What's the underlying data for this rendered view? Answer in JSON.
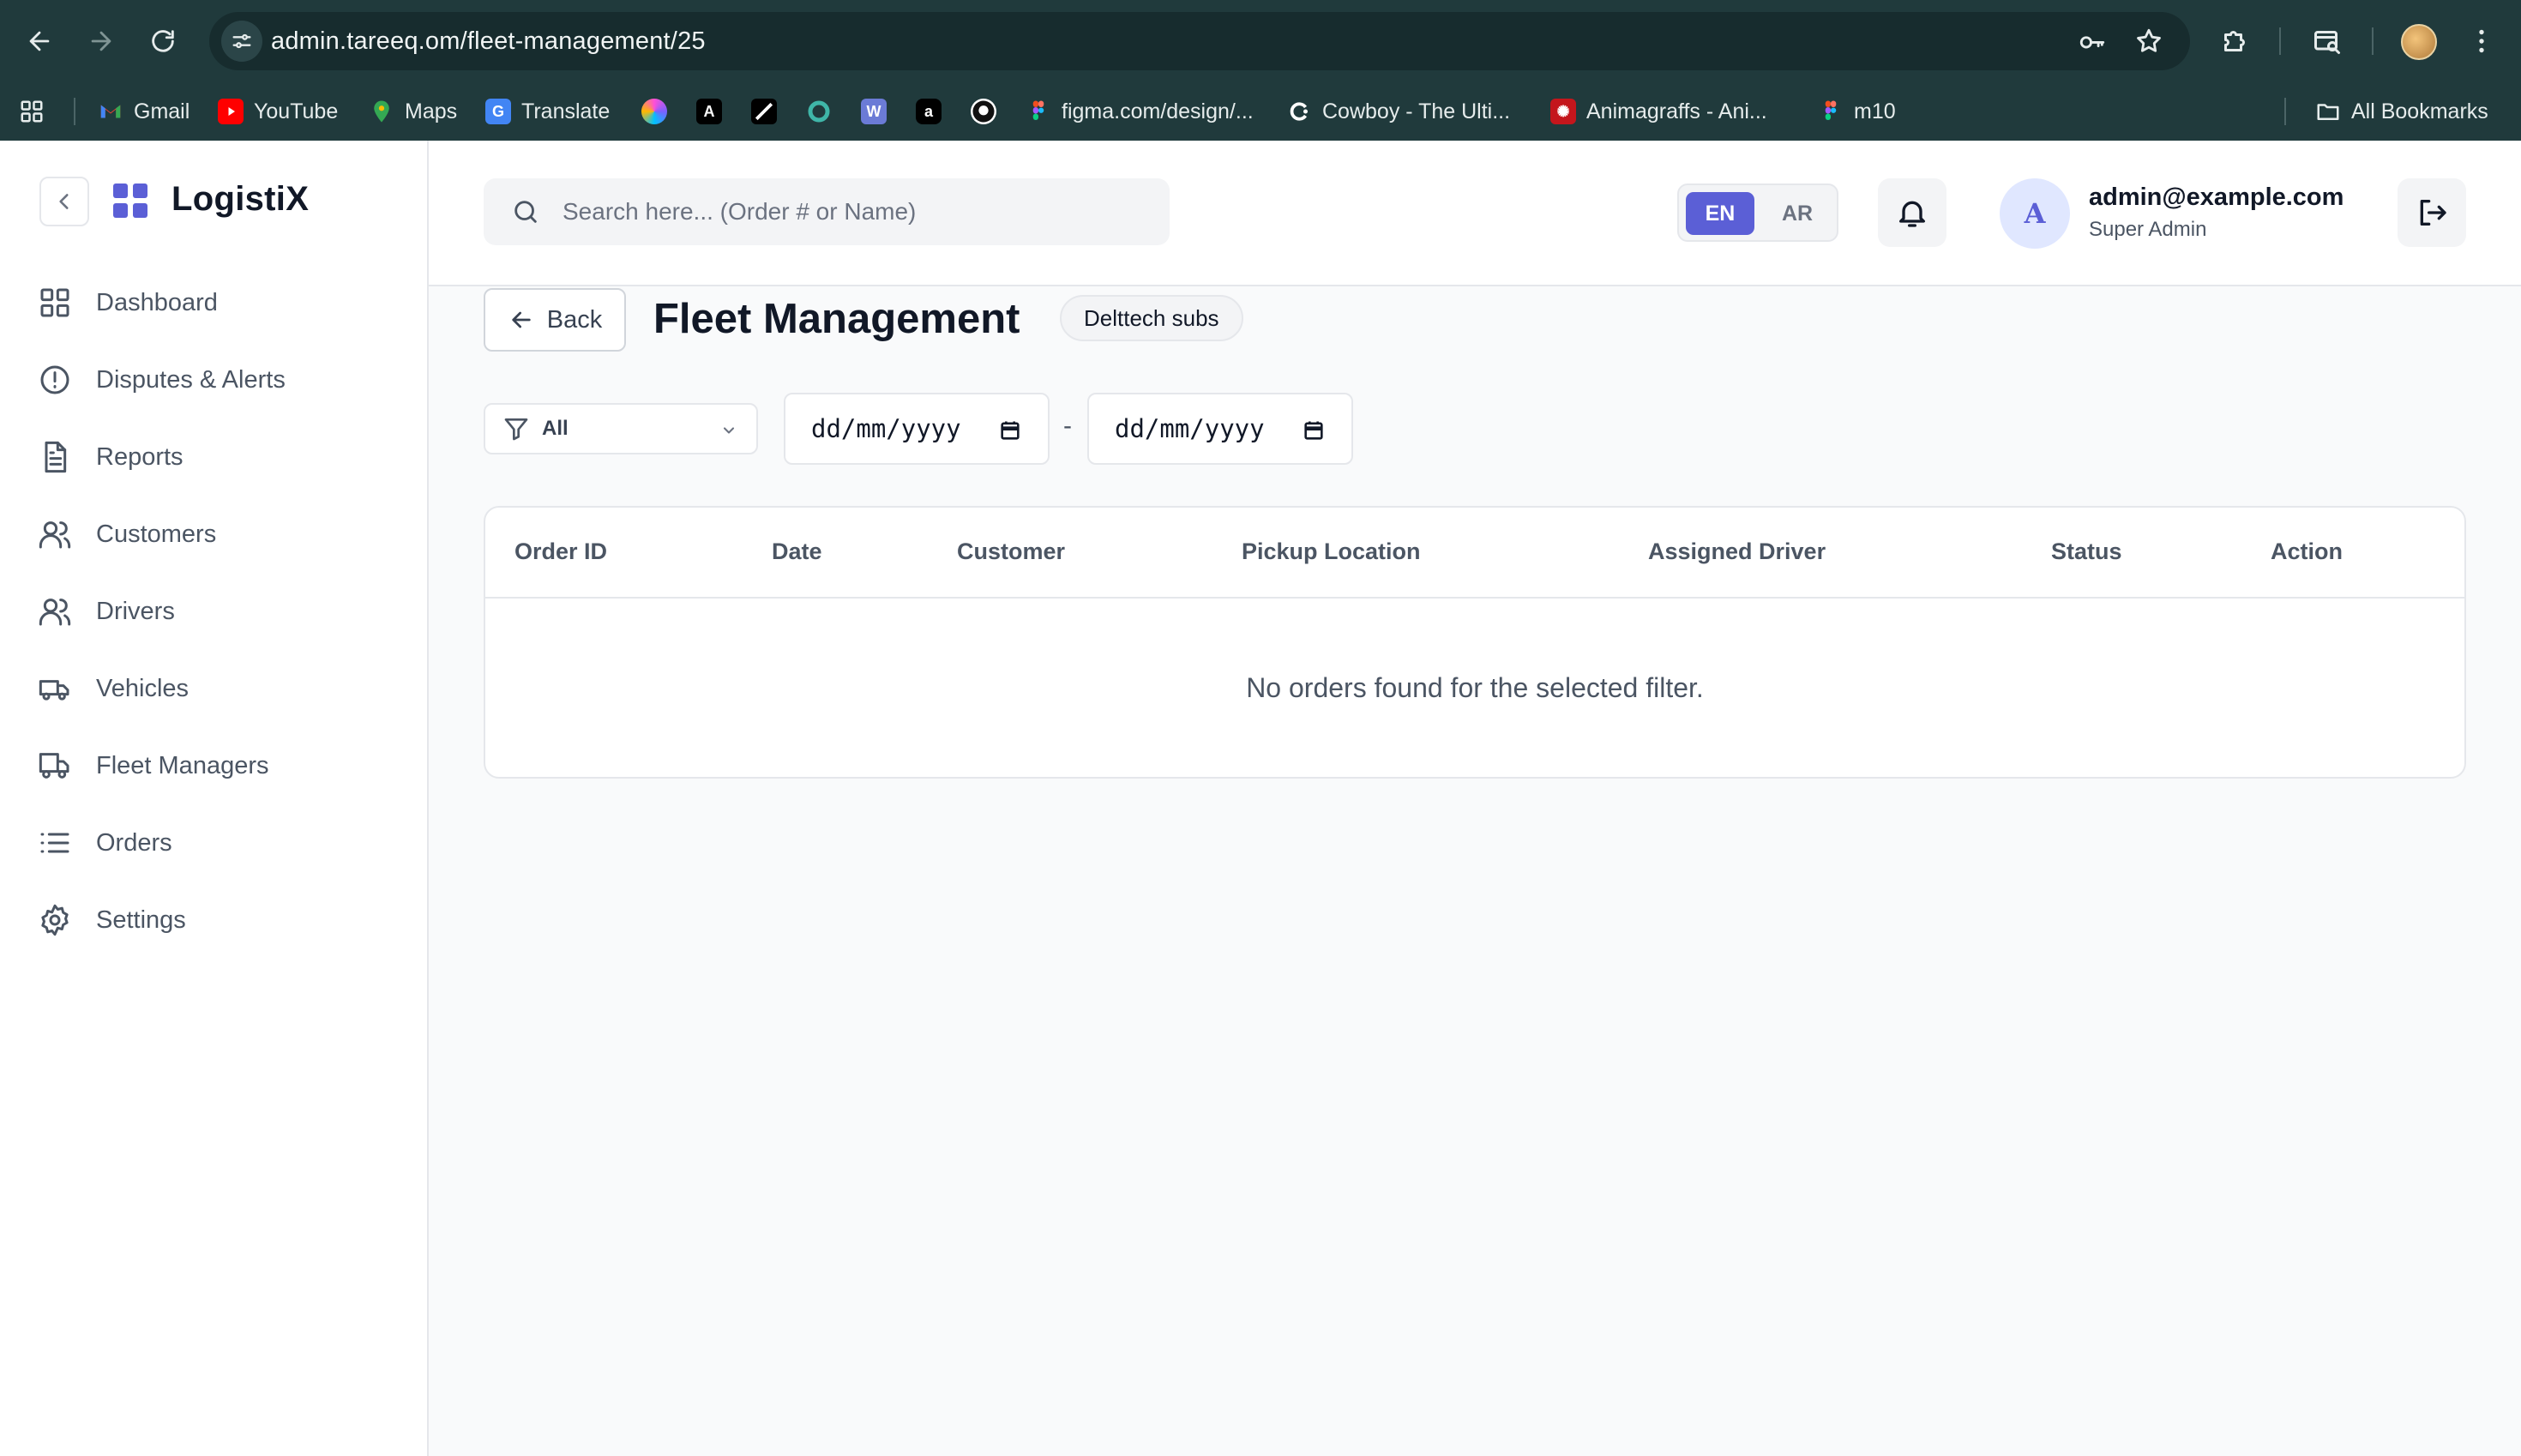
{
  "browser": {
    "url": "admin.tareeq.om/fleet-management/25",
    "bookmarks": [
      {
        "label": "Gmail",
        "icon": "gmail-icon"
      },
      {
        "label": "YouTube",
        "icon": "youtube-icon"
      },
      {
        "label": "Maps",
        "icon": "maps-icon"
      },
      {
        "label": "Translate",
        "icon": "translate-icon"
      },
      {
        "label": "",
        "icon": "gradient-orb-icon"
      },
      {
        "label": "",
        "icon": "a-logo-icon"
      },
      {
        "label": "",
        "icon": "pen-logo-icon"
      },
      {
        "label": "",
        "icon": "teal-knot-icon"
      },
      {
        "label": "",
        "icon": "w-logo-icon"
      },
      {
        "label": "",
        "icon": "a-circle-icon"
      },
      {
        "label": "",
        "icon": "github-icon"
      },
      {
        "label": "figma.com/design/...",
        "icon": "figma-icon"
      },
      {
        "label": "Cowboy - The Ulti...",
        "icon": "cowboy-icon"
      },
      {
        "label": "Animagraffs - Ani...",
        "icon": "animagraffs-icon"
      },
      {
        "label": "m10",
        "icon": "figma-icon"
      }
    ],
    "all_bookmarks": "All Bookmarks"
  },
  "sidebar": {
    "brand": "LogistiX",
    "items": [
      {
        "label": "Dashboard",
        "icon": "grid-icon"
      },
      {
        "label": "Disputes & Alerts",
        "icon": "alert-circle-icon"
      },
      {
        "label": "Reports",
        "icon": "file-text-icon"
      },
      {
        "label": "Customers",
        "icon": "users-icon"
      },
      {
        "label": "Drivers",
        "icon": "users-icon"
      },
      {
        "label": "Vehicles",
        "icon": "truck-icon"
      },
      {
        "label": "Fleet Managers",
        "icon": "truck-icon"
      },
      {
        "label": "Orders",
        "icon": "list-icon"
      },
      {
        "label": "Settings",
        "icon": "gear-icon"
      }
    ]
  },
  "header": {
    "search_placeholder": "Search here... (Order # or Name)",
    "lang_active": "EN",
    "lang_other": "AR",
    "avatar_initial": "A",
    "user_email": "admin@example.com",
    "user_role": "Super Admin"
  },
  "page": {
    "back_label": "Back",
    "title": "Fleet Management",
    "tag": "Delttech subs",
    "filter_value": "All",
    "date_from": "dd/mm/yyyy",
    "date_to": "dd/mm/yyyy",
    "date_separator": "-"
  },
  "table": {
    "columns": [
      "Order ID",
      "Date",
      "Customer",
      "Pickup Location",
      "Assigned Driver",
      "Status",
      "Action"
    ],
    "rows": [],
    "empty_message": "No orders found for the selected filter."
  },
  "colors": {
    "accent": "#5b5fd6",
    "chrome_bg": "#203a3c"
  }
}
